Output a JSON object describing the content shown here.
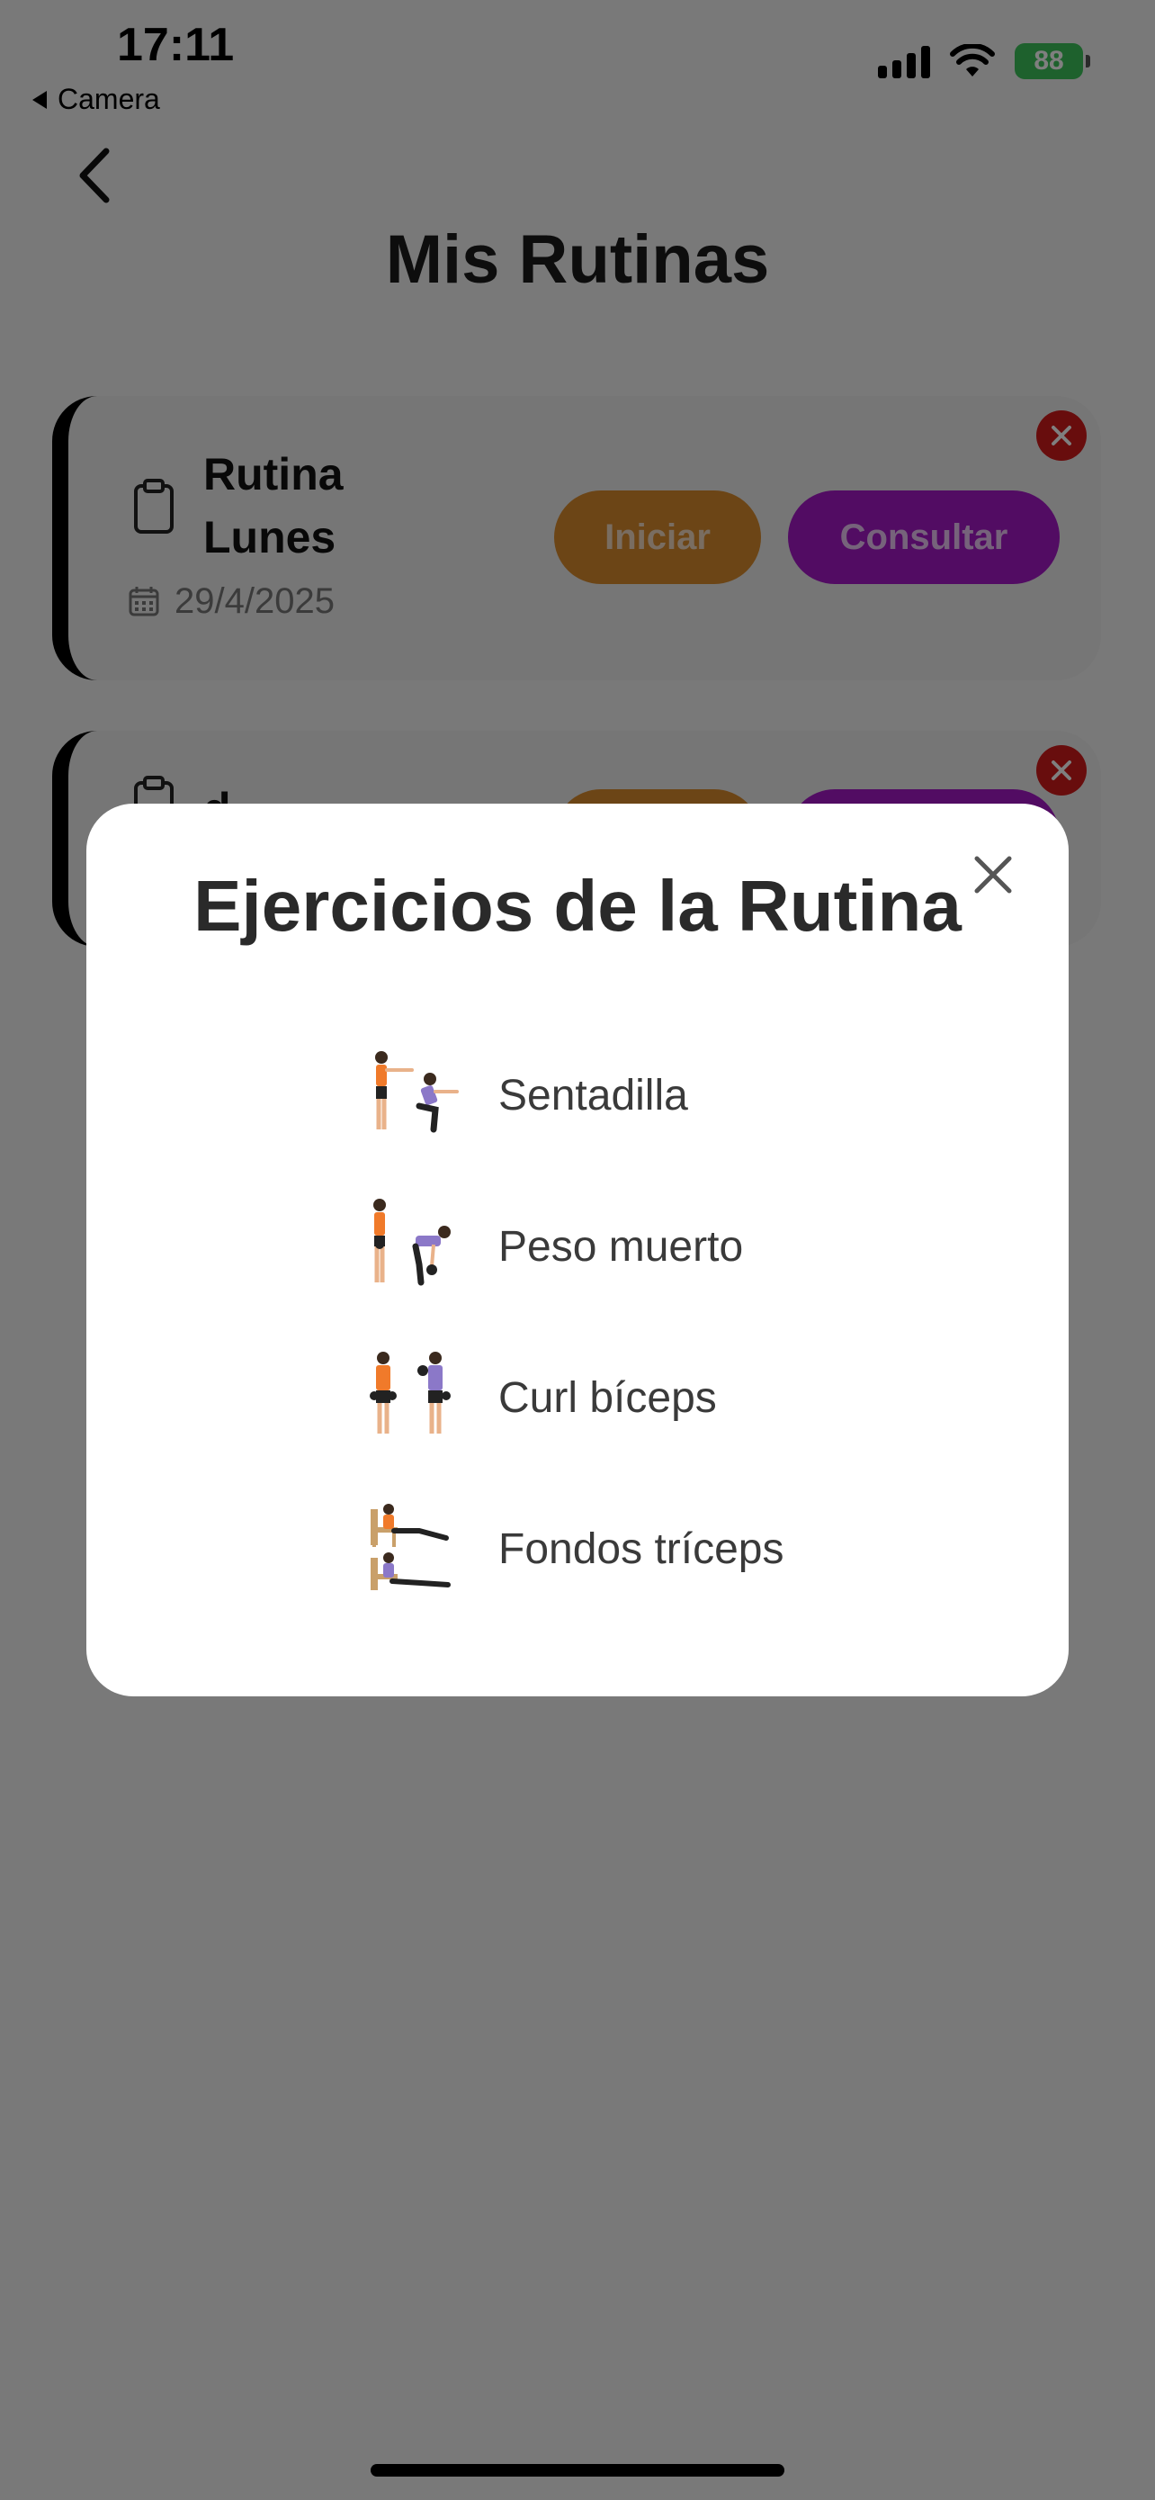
{
  "status_bar": {
    "time": "17:11",
    "back_app": "Camera",
    "battery": "88"
  },
  "page": {
    "title": "Mis Rutinas"
  },
  "routines": [
    {
      "name_line1": "Rutina",
      "name_line2": "Lunes",
      "date": "29/4/2025",
      "start_label": "Iniciar",
      "view_label": "Consultar"
    },
    {
      "name_line1": "d",
      "name_line2": "",
      "date": "",
      "start_label": "",
      "view_label": ""
    }
  ],
  "modal": {
    "title": "Ejercicios de la Rutina",
    "exercises": [
      {
        "name": "Sentadilla",
        "icon": "squat-illustration"
      },
      {
        "name": "Peso muerto",
        "icon": "deadlift-illustration"
      },
      {
        "name": "Curl bíceps",
        "icon": "bicep-curl-illustration"
      },
      {
        "name": "Fondos tríceps",
        "icon": "tricep-dips-illustration"
      }
    ]
  },
  "colors": {
    "start_button": "#d98a2c",
    "view_button": "#a419c6",
    "delete_button": "#d11b1b",
    "overlay": "rgba(0,0,0,0.5)"
  }
}
